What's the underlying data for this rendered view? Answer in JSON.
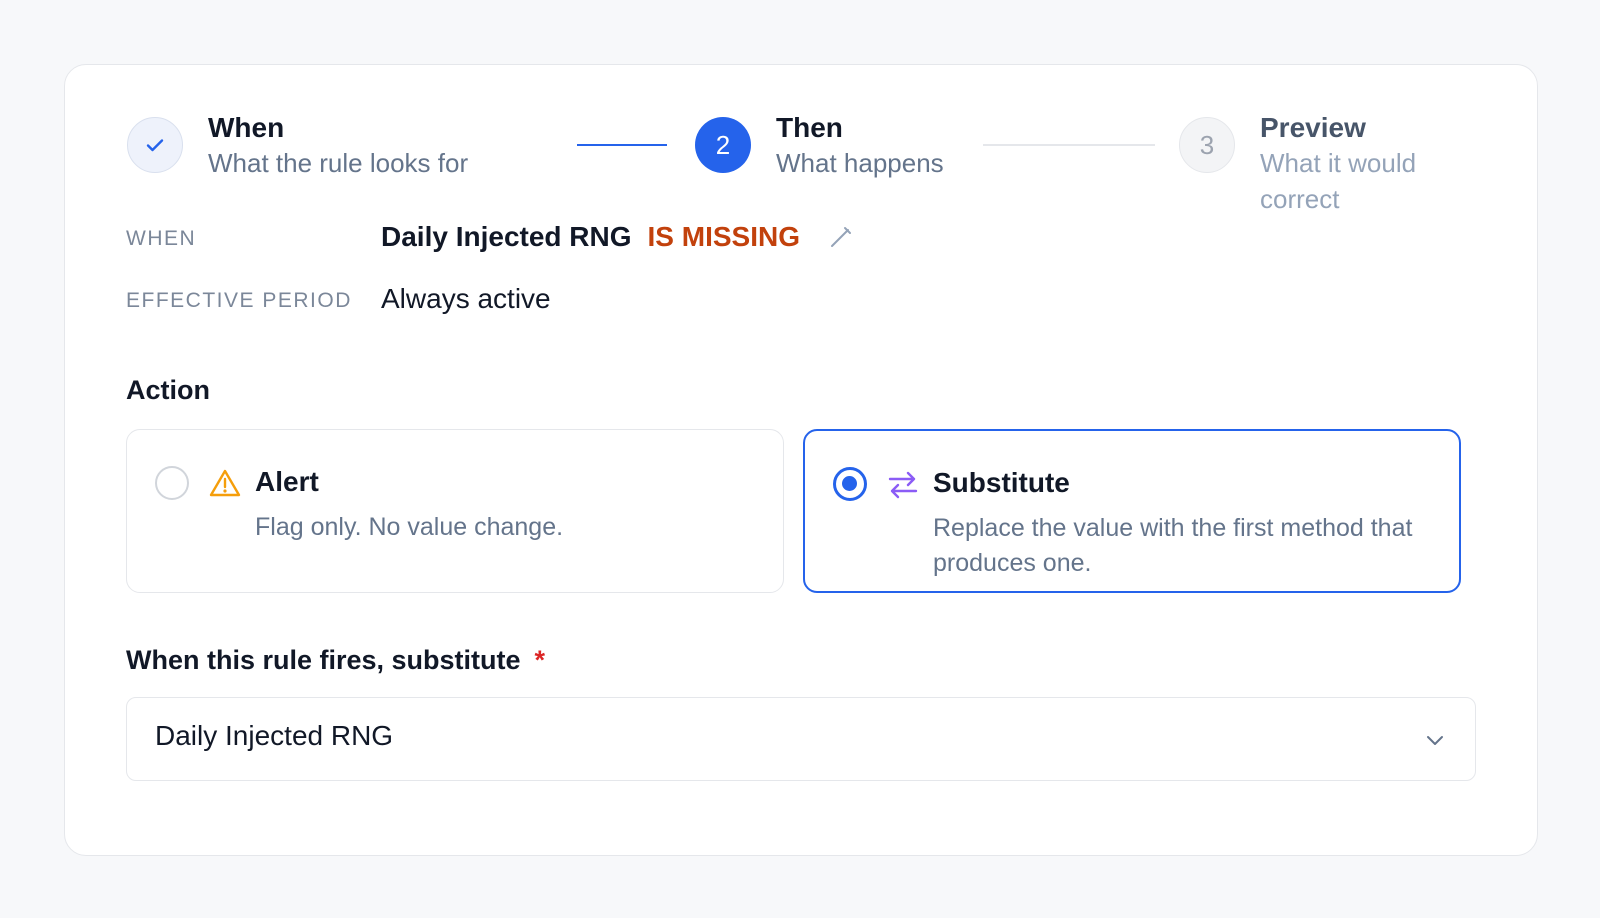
{
  "stepper": {
    "steps": [
      {
        "number": "1",
        "title": "When",
        "subtitle": "What the rule looks for",
        "status": "complete"
      },
      {
        "number": "2",
        "title": "Then",
        "subtitle": "What happens",
        "status": "active"
      },
      {
        "number": "3",
        "title": "Preview",
        "subtitle": "What it would correct",
        "status": "pending"
      }
    ]
  },
  "summary": {
    "when_label": "WHEN",
    "when_source": "Daily Injected RNG",
    "when_condition": "IS MISSING",
    "period_label": "EFFECTIVE PERIOD",
    "period_value": "Always active"
  },
  "action": {
    "heading": "Action",
    "options": [
      {
        "title": "Alert",
        "description": "Flag only. No value change.",
        "selected": false,
        "icon": "warning-icon"
      },
      {
        "title": "Substitute",
        "description": "Replace the value with the first method that produces one.",
        "selected": true,
        "icon": "swap-arrows-icon"
      }
    ]
  },
  "substitute_field": {
    "label": "When this rule fires, substitute",
    "required_marker": "*",
    "value": "Daily Injected RNG"
  },
  "colors": {
    "accent": "#2563eb",
    "condition": "#c2410c",
    "warning": "#f59e0b",
    "swap": "#8b5cf6",
    "required": "#dc2626"
  }
}
